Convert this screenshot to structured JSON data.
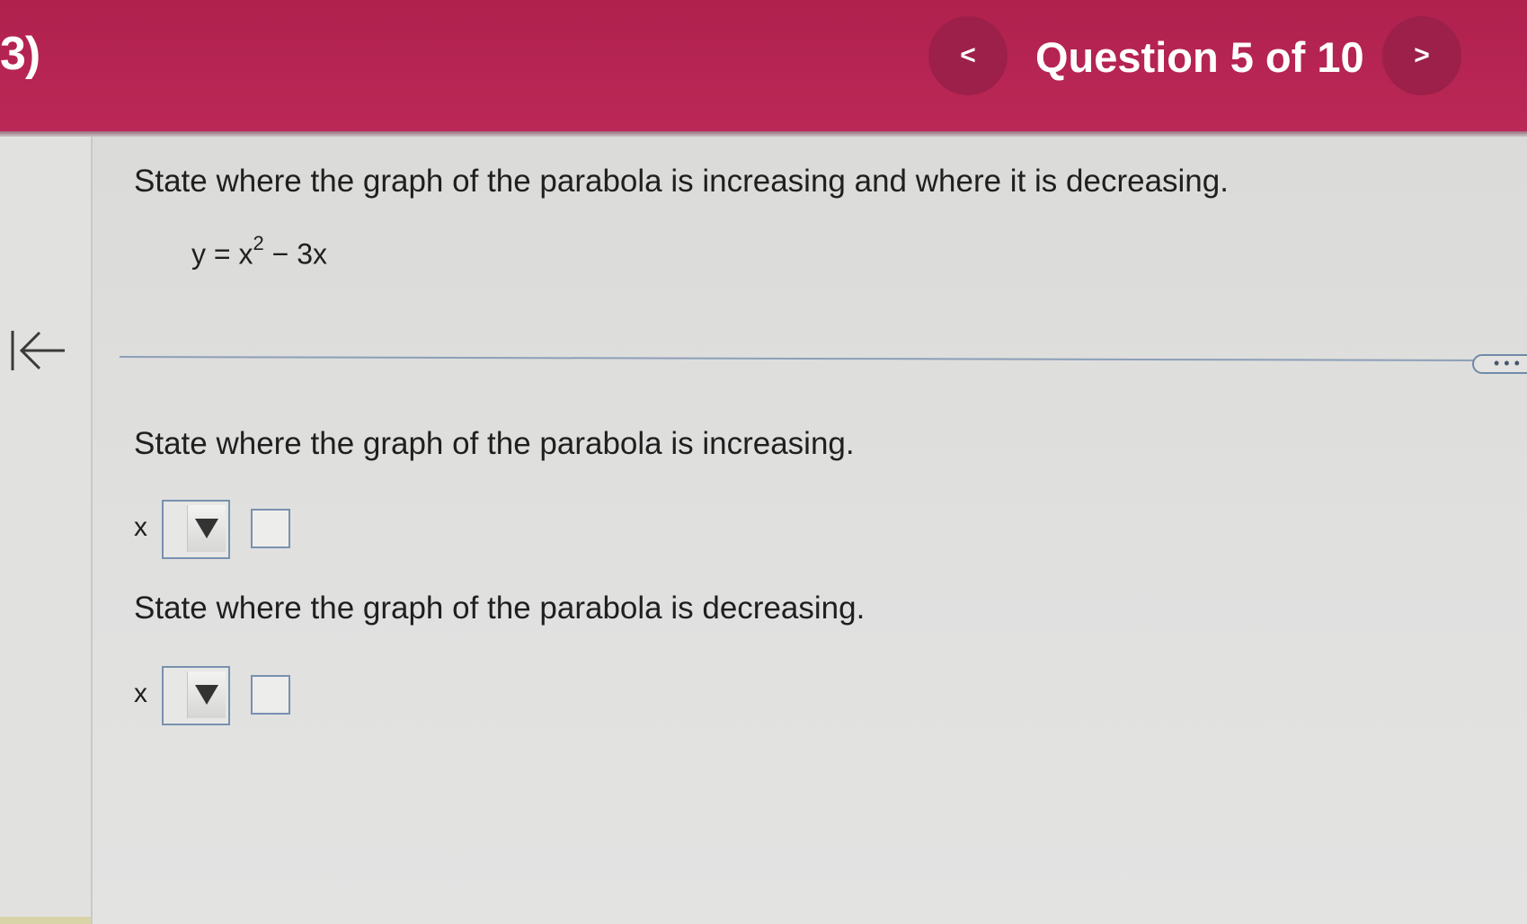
{
  "header": {
    "question_number": "3)",
    "prev_label": "<",
    "counter": "Question 5 of 10",
    "next_label": ">"
  },
  "question": {
    "prompt": "State where the graph of the parabola is increasing and where it is decreasing.",
    "equation_lhs": "y = x",
    "equation_exp": "2",
    "equation_rhs": " − 3x"
  },
  "more_button": "• • •",
  "parts": {
    "increasing": {
      "prompt": "State where the graph of the parabola is increasing.",
      "variable": "x",
      "value": ""
    },
    "decreasing": {
      "prompt": "State where the graph of the parabola is decreasing.",
      "variable": "x",
      "value": ""
    }
  },
  "colors": {
    "header": "#b0214e",
    "nav_button": "#9c2049",
    "input_border": "#7891af"
  },
  "icons": {
    "back": "collapse-left-arrow-icon",
    "dropdown": "triangle-down-icon"
  }
}
